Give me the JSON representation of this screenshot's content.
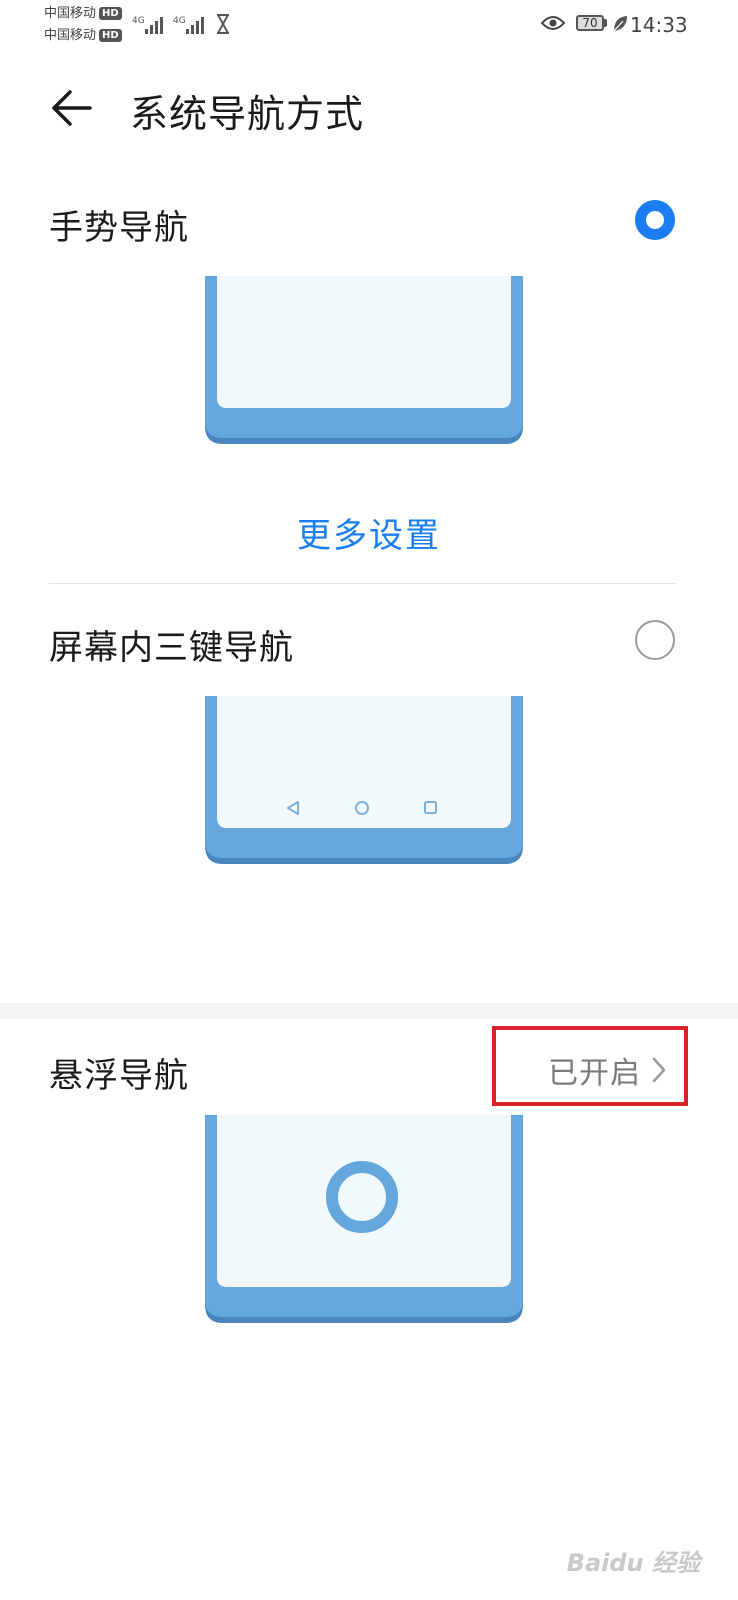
{
  "status_bar": {
    "carrier1": "中国移动",
    "carrier2": "中国移动",
    "hd_label": "HD",
    "net1": "4G",
    "net2": "4G",
    "battery": "70",
    "time": "14:33"
  },
  "header": {
    "title": "系统导航方式"
  },
  "options": {
    "gesture": {
      "label": "手势导航",
      "selected": true,
      "more_link": "更多设置"
    },
    "three_key": {
      "label": "屏幕内三键导航",
      "selected": false
    },
    "floating": {
      "label": "悬浮导航",
      "status": "已开启"
    }
  },
  "watermark": {
    "text": "Baidu 经验"
  },
  "colors": {
    "accent": "#1a7df1",
    "phone_frame": "#63a7dc",
    "phone_screen": "#f2f9fd",
    "highlight": "#d9202b"
  }
}
